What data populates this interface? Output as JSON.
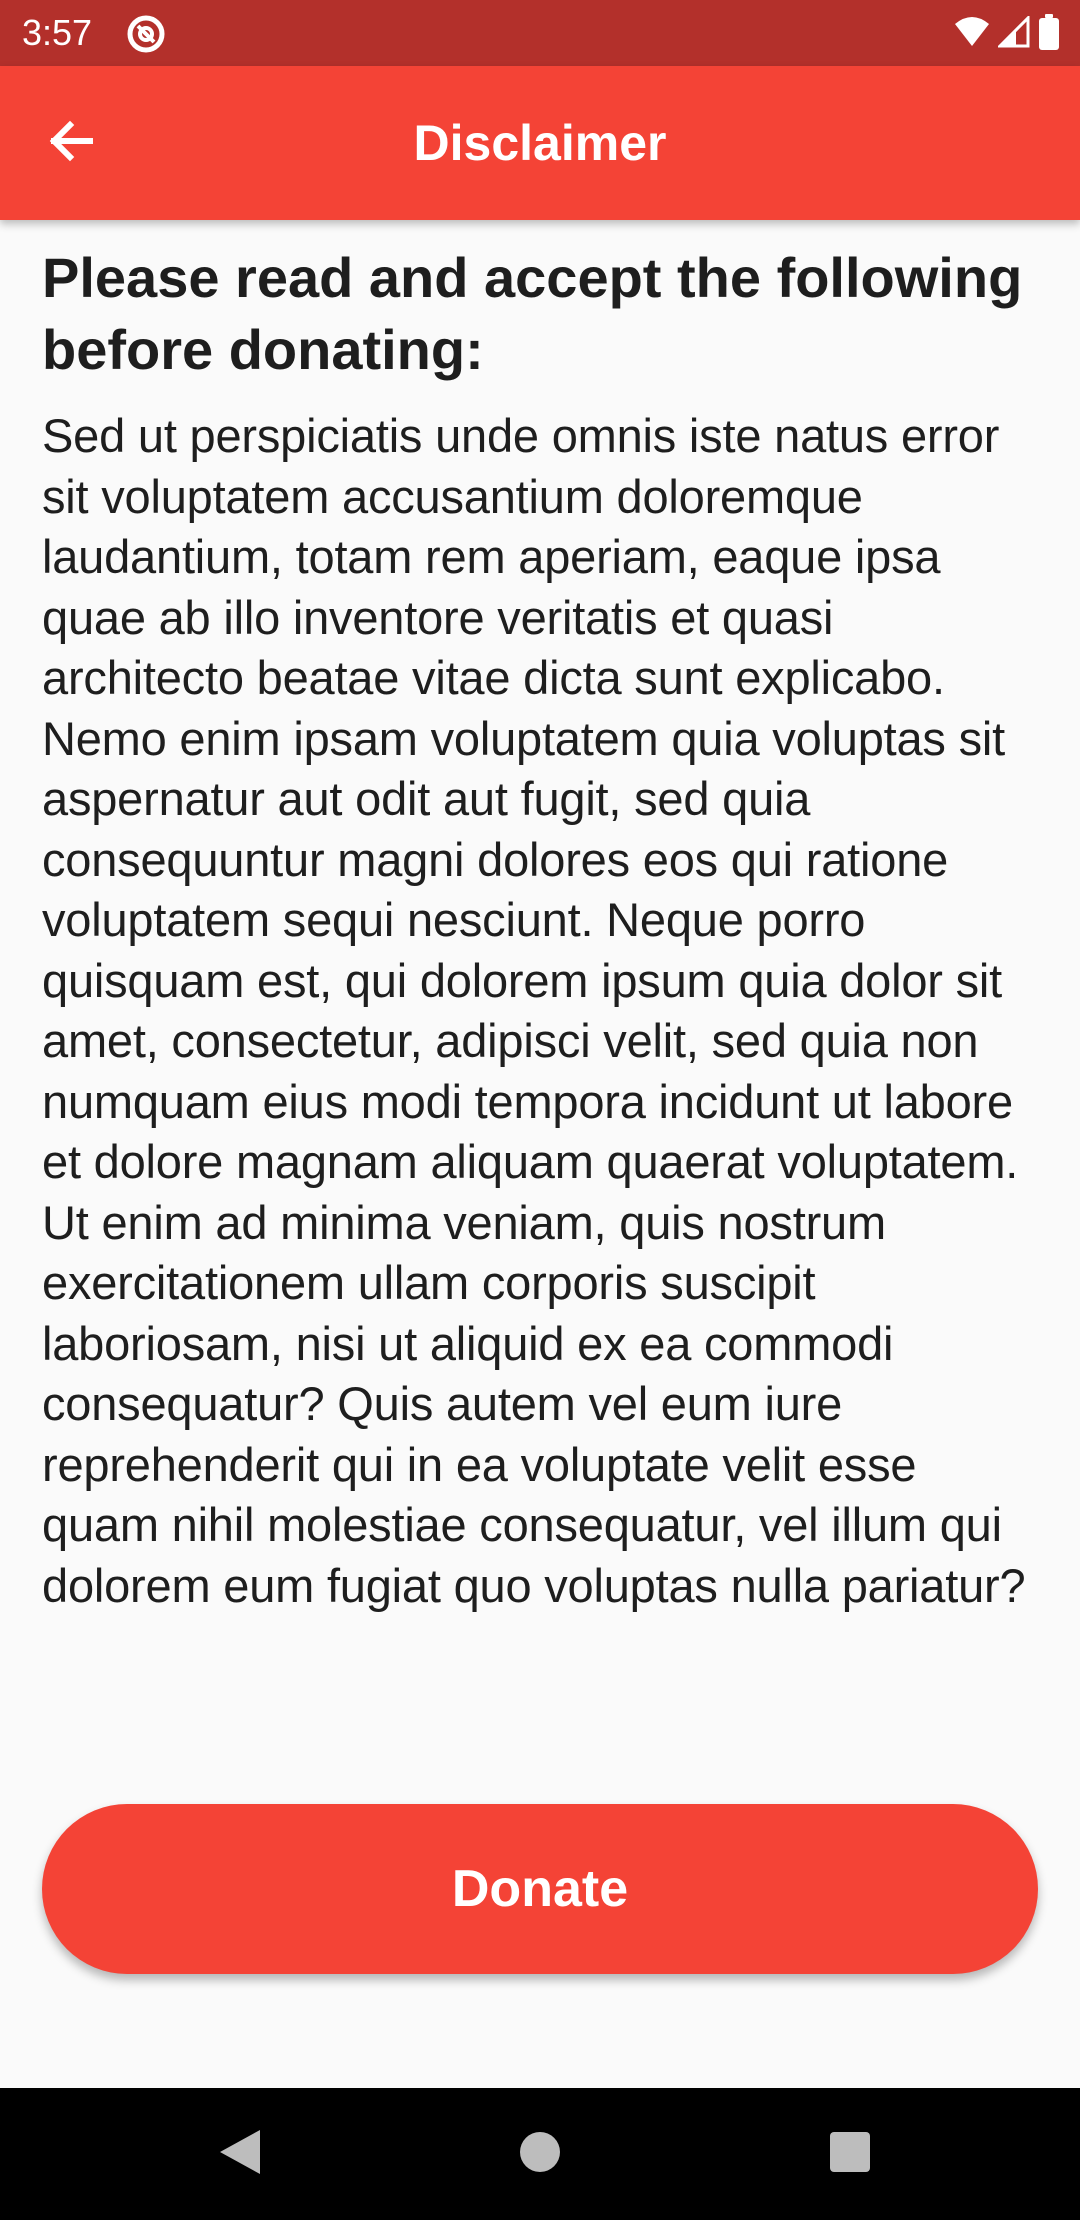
{
  "status_bar": {
    "time": "3:57",
    "app_icon": "at-sign-icon",
    "wifi_icon": "wifi-icon",
    "signal_icon": "cell-signal-icon",
    "battery_icon": "battery-icon"
  },
  "app_bar": {
    "title": "Disclaimer",
    "back_icon": "arrow-back-icon",
    "color": "#f44336"
  },
  "content": {
    "heading": "Please read and accept the following before donating:",
    "body": "Sed ut perspiciatis unde omnis iste natus error sit voluptatem accusantium doloremque laudantium, totam rem aperiam, eaque ipsa quae ab illo inventore veritatis et quasi architecto beatae vitae dicta sunt explicabo. Nemo enim ipsam voluptatem quia voluptas sit aspernatur aut odit aut fugit, sed quia consequuntur magni dolores eos qui ratione voluptatem sequi nesciunt. Neque porro quisquam est, qui dolorem ipsum quia dolor sit amet, consectetur, adipisci velit, sed quia non numquam eius modi tempora incidunt ut labore et dolore magnam aliquam quaerat voluptatem. Ut enim ad minima veniam, quis nostrum exercitationem ullam corporis suscipit laboriosam, nisi ut aliquid ex ea commodi consequatur? Quis autem vel eum iure reprehenderit qui in ea voluptate velit esse quam nihil molestiae consequatur, vel illum qui dolorem eum fugiat quo voluptas nulla pariatur?"
  },
  "donate_button": {
    "label": "Donate",
    "color": "#f44336"
  },
  "nav_bar": {
    "back_icon": "nav-back-triangle-icon",
    "home_icon": "nav-home-circle-icon",
    "recents_icon": "nav-recents-square-icon"
  }
}
